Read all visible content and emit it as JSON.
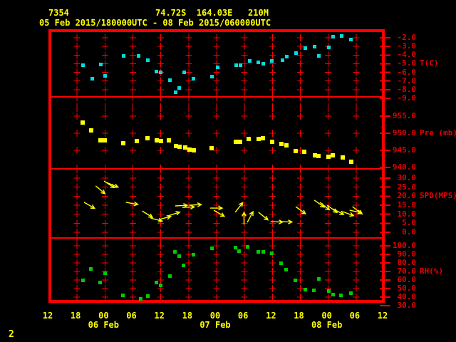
{
  "header": {
    "station_id": "7354",
    "location_line": "74.72S  164.03E   210M",
    "period_line": "05 Feb 2015/180000UTC - 08 Feb 2015/060000UTC"
  },
  "page_number": "2",
  "colors": {
    "background": "#000000",
    "grid": "#ff0000",
    "axis_text": "#e60000",
    "x_axis_text": "#ffff00",
    "temp": "#00dede",
    "pressure": "#ffff00",
    "wind": "#ffff00",
    "rh": "#00cc00"
  },
  "x_axis": {
    "grid_hours": [
      6,
      12,
      18,
      24,
      30,
      36,
      42,
      48,
      54,
      60,
      66
    ],
    "hour_labels": [
      {
        "h": 0,
        "text": "12"
      },
      {
        "h": 6,
        "text": "18"
      },
      {
        "h": 12,
        "text": "00"
      },
      {
        "h": 18,
        "text": "06"
      },
      {
        "h": 24,
        "text": "12"
      },
      {
        "h": 30,
        "text": "18"
      },
      {
        "h": 36,
        "text": "00"
      },
      {
        "h": 42,
        "text": "06"
      },
      {
        "h": 48,
        "text": "12"
      },
      {
        "h": 54,
        "text": "18"
      },
      {
        "h": 60,
        "text": "00"
      },
      {
        "h": 66,
        "text": "06"
      },
      {
        "h": 72,
        "text": "12"
      }
    ],
    "date_labels": [
      {
        "h": 12,
        "text": "06 Feb"
      },
      {
        "h": 36,
        "text": "07 Feb"
      },
      {
        "h": 60,
        "text": "08 Feb"
      }
    ]
  },
  "panels": [
    {
      "key": "temp",
      "title": "T(C)",
      "title_v": -5,
      "grid_values": [
        -2,
        -3,
        -4,
        -5,
        -6,
        -7,
        -8
      ],
      "ticks": [
        {
          "v": -2,
          "text": "-2.0"
        },
        {
          "v": -3,
          "text": "-3.0"
        },
        {
          "v": -4,
          "text": "-4.0"
        },
        {
          "v": -5,
          "text": "-5.0"
        },
        {
          "v": -6,
          "text": "-6.0"
        },
        {
          "v": -7,
          "text": "-7.0"
        },
        {
          "v": -8,
          "text": "-8.0"
        },
        {
          "v": -9,
          "text": "-9.0"
        }
      ]
    },
    {
      "key": "pres",
      "title": "Pre (mb)",
      "title_v": 950,
      "grid_values": [
        955,
        950,
        945
      ],
      "ticks": [
        {
          "v": 955,
          "text": "955.0"
        },
        {
          "v": 950,
          "text": "950.0"
        },
        {
          "v": 945,
          "text": "945.0"
        },
        {
          "v": 940,
          "text": "940.0"
        }
      ]
    },
    {
      "key": "spd",
      "title": "SPD(MPS)",
      "title_v": 20,
      "grid_values": [
        30,
        25,
        20,
        15,
        10,
        5,
        0
      ],
      "ticks": [
        {
          "v": 30,
          "text": "30.0"
        },
        {
          "v": 25,
          "text": "25.0"
        },
        {
          "v": 20,
          "text": "20.0"
        },
        {
          "v": 15,
          "text": "15.0"
        },
        {
          "v": 10,
          "text": "10.0"
        },
        {
          "v": 5,
          "text": "5.0"
        },
        {
          "v": 0,
          "text": "0.0"
        }
      ]
    },
    {
      "key": "rh",
      "title": "RH(%)",
      "title_v": 70,
      "grid_values": [
        100,
        90,
        80,
        70,
        60,
        50,
        40
      ],
      "ticks": [
        {
          "v": 100,
          "text": "100.0"
        },
        {
          "v": 90,
          "text": "90.0"
        },
        {
          "v": 80,
          "text": "80.0"
        },
        {
          "v": 70,
          "text": "70.0"
        },
        {
          "v": 60,
          "text": "60.0"
        },
        {
          "v": 50,
          "text": "50.0"
        },
        {
          "v": 40,
          "text": "40.0"
        },
        {
          "v": 30,
          "text": "30.0"
        }
      ]
    }
  ],
  "chart_data": [
    {
      "type": "scatter",
      "name": "temperature",
      "ylabel": "T(C)",
      "ylim": [
        -9,
        -2
      ],
      "x_unit": "hours after 05 Feb 2015 1200UTC",
      "xlim": [
        0,
        72
      ],
      "points": [
        [
          7.2,
          -5.2
        ],
        [
          9.2,
          -6.7
        ],
        [
          11.1,
          -5.1
        ],
        [
          12.1,
          -6.4
        ],
        [
          16,
          -4.1
        ],
        [
          19.2,
          -4.1
        ],
        [
          21.2,
          -4.6
        ],
        [
          23.1,
          -5.9
        ],
        [
          24,
          -6
        ],
        [
          26,
          -6.9
        ],
        [
          27.2,
          -8.3
        ],
        [
          27.9,
          -7.8
        ],
        [
          29,
          -6
        ],
        [
          31,
          -6.7
        ],
        [
          35,
          -6.5
        ],
        [
          36.2,
          -5.4
        ],
        [
          40.2,
          -5.2
        ],
        [
          41.1,
          -5.2
        ],
        [
          43.1,
          -4.7
        ],
        [
          45,
          -4.8
        ],
        [
          46.1,
          -5
        ],
        [
          47.9,
          -4.7
        ],
        [
          50.1,
          -4.6
        ],
        [
          51.1,
          -4.2
        ],
        [
          53.1,
          -3.8
        ],
        [
          55,
          -3.2
        ],
        [
          57.1,
          -3
        ],
        [
          58,
          -4.1
        ],
        [
          60.2,
          -3.1
        ],
        [
          61.1,
          -1.9
        ],
        [
          62.9,
          -1.8
        ],
        [
          64.9,
          -2.2
        ]
      ]
    },
    {
      "type": "scatter",
      "name": "pressure",
      "ylabel": "Pre (mb)",
      "ylim": [
        940,
        955
      ],
      "x_unit": "hours after 05 Feb 2015 1200UTC",
      "xlim": [
        0,
        72
      ],
      "points": [
        [
          7.2,
          953.1
        ],
        [
          9,
          950.8
        ],
        [
          11,
          947.9
        ],
        [
          11.9,
          947.9
        ],
        [
          15.9,
          947.1
        ],
        [
          18.9,
          947.7
        ],
        [
          21.2,
          948.5
        ],
        [
          23.1,
          947.9
        ],
        [
          24,
          947.7
        ],
        [
          25.8,
          947.9
        ],
        [
          27.2,
          946.3
        ],
        [
          28.1,
          946
        ],
        [
          29.2,
          945.8
        ],
        [
          30.2,
          945.2
        ],
        [
          31.1,
          945
        ],
        [
          34.9,
          945.7
        ],
        [
          40.2,
          947.5
        ],
        [
          41.1,
          947.5
        ],
        [
          42.9,
          948.3
        ],
        [
          45,
          948.3
        ],
        [
          46,
          948.5
        ],
        [
          47.9,
          947.5
        ],
        [
          49.9,
          946.9
        ],
        [
          51,
          946.5
        ],
        [
          53,
          944.8
        ],
        [
          54.8,
          944.6
        ],
        [
          57.1,
          943.5
        ],
        [
          57.9,
          943.3
        ],
        [
          60,
          943.1
        ],
        [
          60.9,
          943.5
        ],
        [
          63.1,
          942.9
        ],
        [
          64.9,
          941.7
        ]
      ]
    },
    {
      "type": "wind_vectors",
      "name": "wind speed & direction",
      "ylabel": "SPD(MPS)",
      "ylim": [
        0,
        30
      ],
      "x_unit": "hours after 05 Feb 2015 1200UTC",
      "xlim": [
        0,
        72
      ],
      "dir_convention": "screen angle in degrees: 0 = arrow points right, positive = downward",
      "points": [
        [
          7.5,
          16.6,
          30
        ],
        [
          10,
          25.7,
          40
        ],
        [
          11.8,
          28.4,
          33
        ],
        [
          12.4,
          27.5,
          22
        ],
        [
          16.5,
          16.6,
          10
        ],
        [
          20,
          11.8,
          32
        ],
        [
          21.8,
          7.9,
          15
        ],
        [
          23.6,
          7.1,
          -14
        ],
        [
          25.6,
          9.1,
          -18
        ],
        [
          27.1,
          14.6,
          -3
        ],
        [
          28.6,
          13.8,
          -2
        ],
        [
          30.1,
          15,
          -3
        ],
        [
          34.6,
          13.4,
          0
        ],
        [
          35.4,
          12.2,
          30
        ],
        [
          40,
          11.1,
          -52
        ],
        [
          41.9,
          4.3,
          -90
        ],
        [
          42.6,
          5.5,
          -62
        ],
        [
          45,
          11.1,
          39
        ],
        [
          47.6,
          5.9,
          2
        ],
        [
          49.6,
          5.9,
          2
        ],
        [
          53,
          14.2,
          36
        ],
        [
          57,
          17.8,
          35
        ],
        [
          58.2,
          16.6,
          38
        ],
        [
          59.8,
          15,
          37
        ],
        [
          61,
          13,
          28
        ],
        [
          63,
          11.5,
          20
        ],
        [
          64.6,
          12.2,
          12
        ],
        [
          65.2,
          14.2,
          37
        ]
      ]
    },
    {
      "type": "scatter",
      "name": "relative humidity",
      "ylabel": "RH(%)",
      "ylim": [
        30,
        100
      ],
      "x_unit": "hours after 05 Feb 2015 1200UTC",
      "xlim": [
        0,
        72
      ],
      "points": [
        [
          7.2,
          60
        ],
        [
          9,
          73
        ],
        [
          11,
          57
        ],
        [
          12.1,
          68
        ],
        [
          15.9,
          42
        ],
        [
          19.7,
          38
        ],
        [
          21.2,
          41
        ],
        [
          23.1,
          57
        ],
        [
          24,
          54
        ],
        [
          26,
          65
        ],
        [
          27,
          93
        ],
        [
          27.9,
          88
        ],
        [
          28.9,
          77
        ],
        [
          31,
          90
        ],
        [
          35,
          97
        ],
        [
          40,
          98
        ],
        [
          40.9,
          94
        ],
        [
          42.7,
          99
        ],
        [
          45,
          93
        ],
        [
          46,
          93
        ],
        [
          47.9,
          91
        ],
        [
          49.9,
          80
        ],
        [
          51,
          72
        ],
        [
          53,
          60
        ],
        [
          55.1,
          49
        ],
        [
          56.9,
          48
        ],
        [
          58,
          61
        ],
        [
          60.2,
          47
        ],
        [
          61.1,
          43
        ],
        [
          62.7,
          42
        ],
        [
          64.9,
          45
        ]
      ]
    }
  ]
}
